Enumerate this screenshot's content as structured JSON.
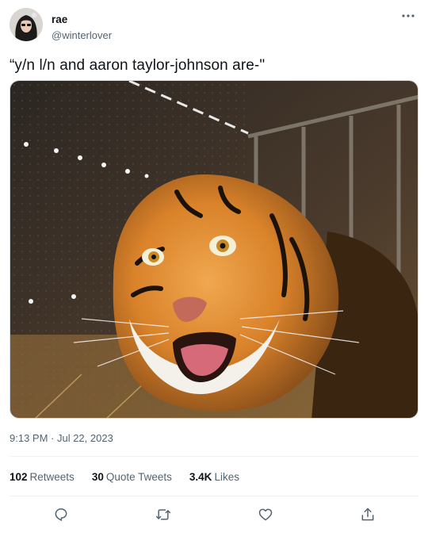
{
  "author": {
    "display_name": "rae",
    "handle": "@winterlover"
  },
  "tweet": {
    "text": "“y/n l/n and aaron taylor-johnson are-\"",
    "timestamp": "9:13 PM · Jul 22, 2023"
  },
  "stats": {
    "retweets_count": "102",
    "retweets_label": "Retweets",
    "quotes_count": "30",
    "quotes_label": "Quote Tweets",
    "likes_count": "3.4K",
    "likes_label": "Likes"
  },
  "actions": [
    "reply-icon",
    "retweet-icon",
    "like-icon",
    "share-icon"
  ],
  "colors": {
    "text_primary": "#0f1419",
    "text_secondary": "#536471",
    "divider": "#eff3f4",
    "icon": "#536471"
  }
}
